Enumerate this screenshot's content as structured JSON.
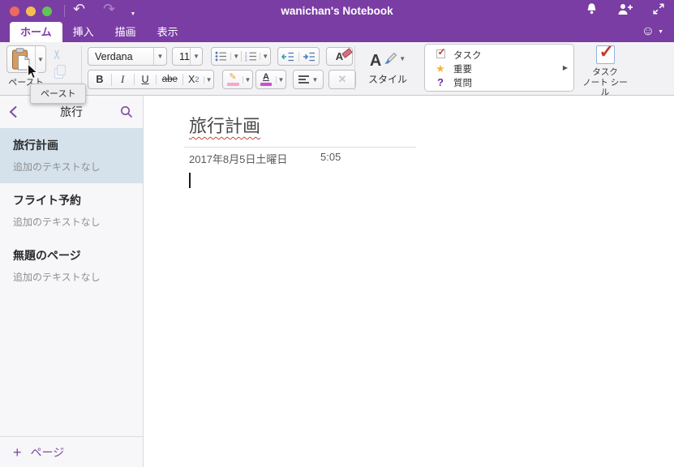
{
  "window": {
    "title": "wanichan's Notebook"
  },
  "tabs": {
    "home": "ホーム",
    "insert": "挿入",
    "draw": "描画",
    "view": "表示"
  },
  "ribbon": {
    "paste": {
      "label": "ペースト",
      "tooltip": "ペースト"
    },
    "font": {
      "name": "Verdana",
      "size": "11"
    },
    "buttons": {
      "bold": "B",
      "italic": "I",
      "underline": "U",
      "strikethrough": "abe",
      "subscript_x": "X",
      "subscript_2": "2",
      "clear_letter": "A",
      "fontcolor_letter": "A",
      "styles_letter": "A"
    },
    "styles_label": "スタイル",
    "tag_gallery": {
      "task": "タスク",
      "important": "重要",
      "question": "質問"
    },
    "tag_button": {
      "line1": "タスク",
      "line2": "ノート シール"
    }
  },
  "sidebar": {
    "section_title": "旅行",
    "pages": [
      {
        "title": "旅行計画",
        "subtitle": "追加のテキストなし"
      },
      {
        "title": "フライト予約",
        "subtitle": "追加のテキストなし"
      },
      {
        "title": "無題のページ",
        "subtitle": "追加のテキストなし"
      }
    ],
    "add_page_label": "ページ"
  },
  "page": {
    "title": "旅行計画",
    "date": "2017年8月5日土曜日",
    "time": "5:05"
  },
  "colors": {
    "titlebar_purple": "#7A3DA4",
    "accent_purple": "#7E4CA0",
    "selected_page_bg": "#D5E2EB",
    "spellcheck_red": "#C8473F"
  }
}
